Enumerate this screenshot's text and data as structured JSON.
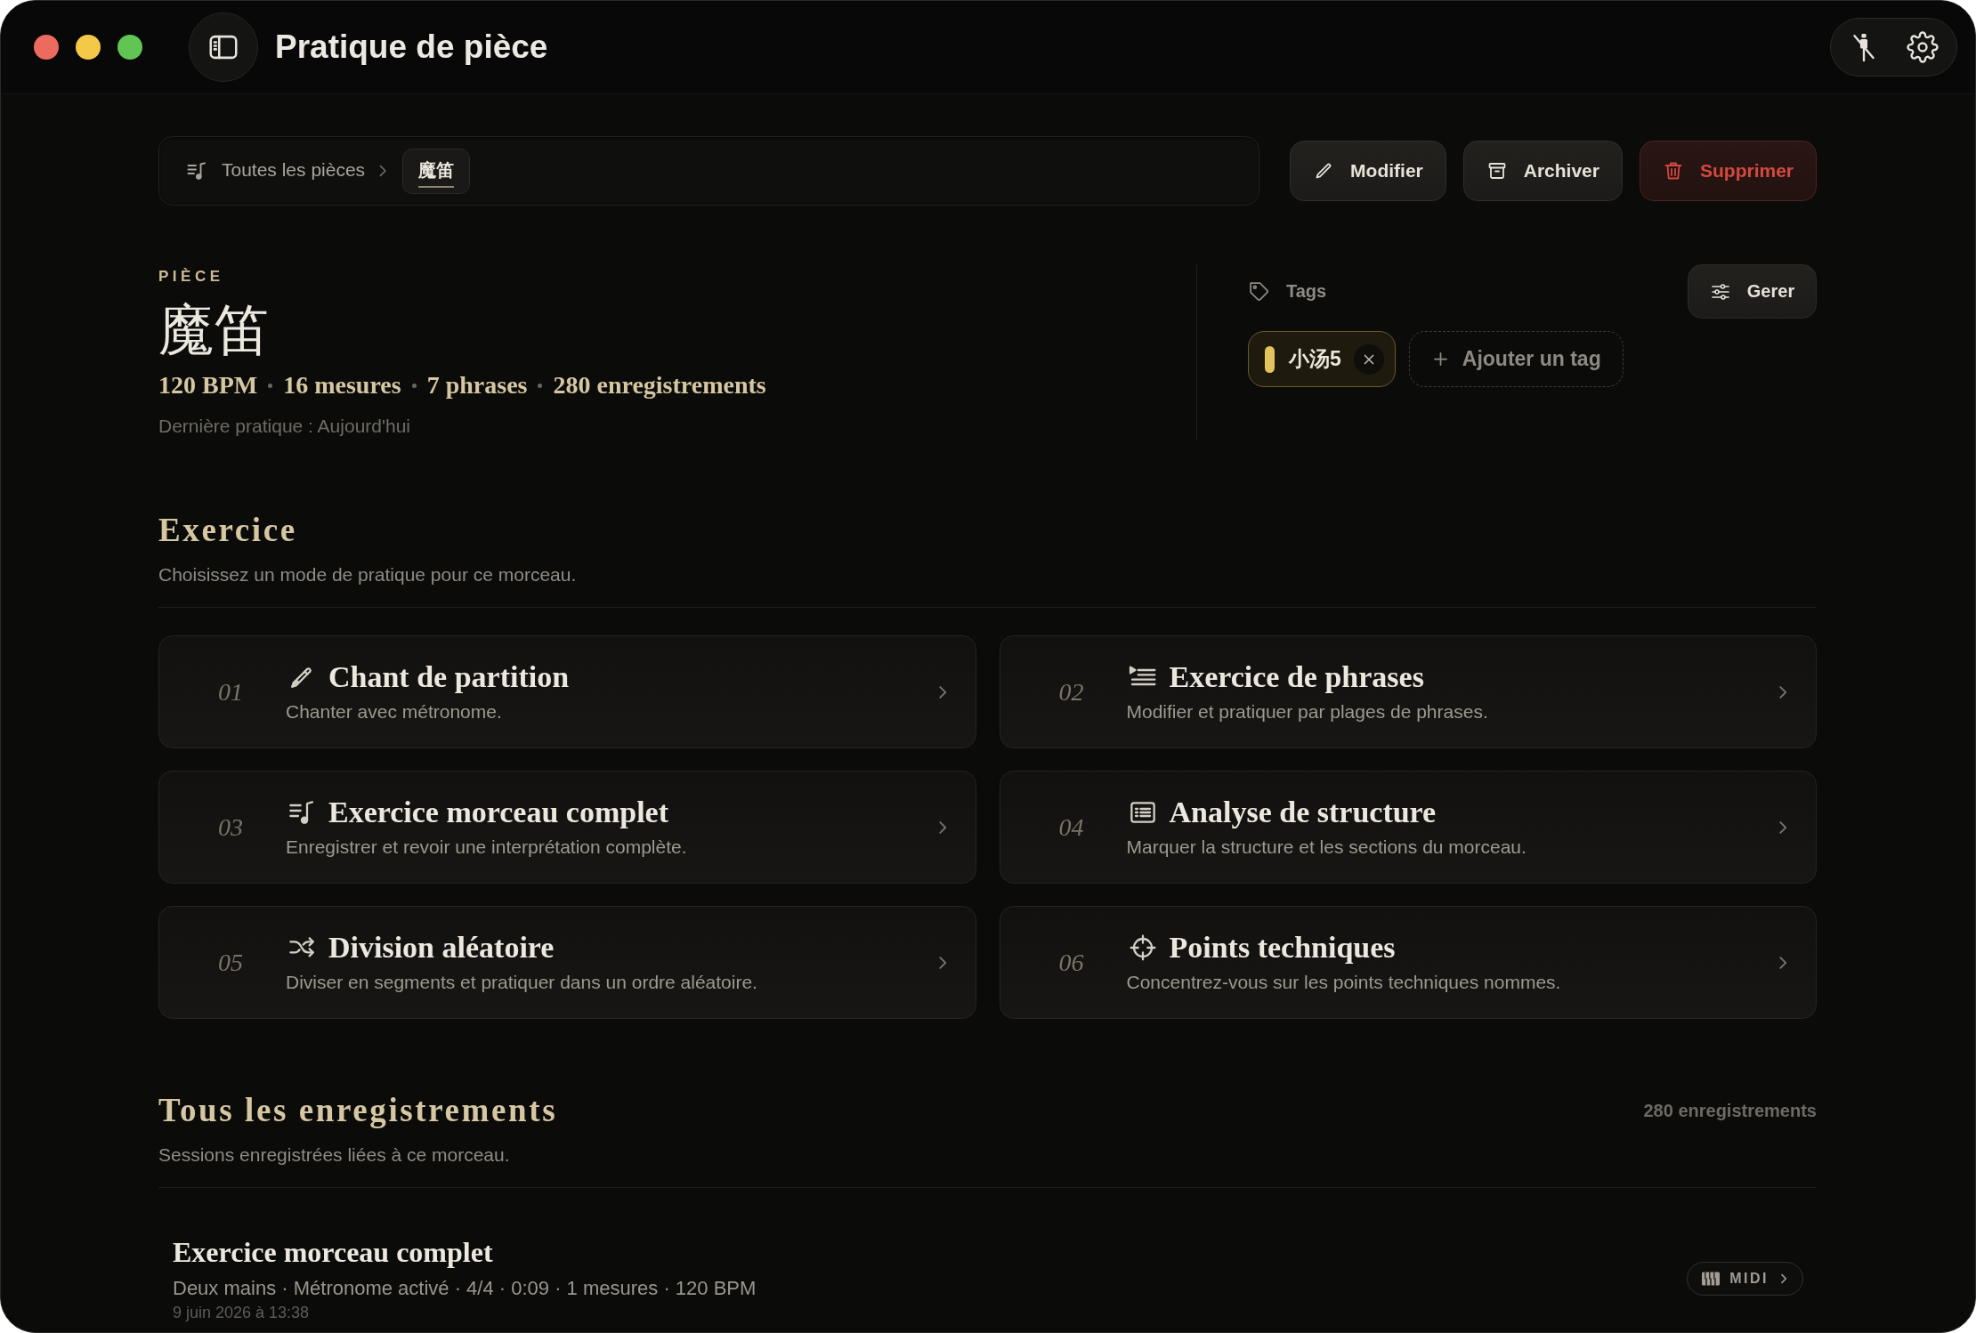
{
  "window": {
    "title": "Pratique de pièce"
  },
  "breadcrumb": [
    {
      "label": "Toutes les pièces",
      "selected": false
    },
    {
      "label": "魔笛",
      "selected": true
    }
  ],
  "actions": [
    {
      "kind": "edit",
      "label": "Modifier"
    },
    {
      "kind": "archive",
      "label": "Archiver"
    },
    {
      "kind": "delete",
      "label": "Supprimer"
    }
  ],
  "piece": {
    "eyebrow": "PIÈCE",
    "title": "魔笛",
    "stats": [
      "120 BPM",
      "16 mesures",
      "7 phrases",
      "280 enregistrements"
    ],
    "last_practice": "Dernière pratique : Aujourd'hui"
  },
  "tags": {
    "label": "Tags",
    "manage_button": "Gerer",
    "items": [
      {
        "label": "小汤5",
        "color": "#e2c35c"
      }
    ],
    "add_button": "Ajouter un tag"
  },
  "exercise": {
    "heading": "Exercice",
    "subtitle": "Choisissez un mode de pratique pour ce morceau.",
    "modes": [
      {
        "number": "01",
        "kind": "sing",
        "title": "Chant de partition",
        "description": "Chanter avec métronome."
      },
      {
        "number": "02",
        "kind": "phrases",
        "title": "Exercice de phrases",
        "description": "Modifier et pratiquer par plages de phrases."
      },
      {
        "number": "03",
        "kind": "full",
        "title": "Exercice morceau complet",
        "description": "Enregistrer et revoir une interprétation complète."
      },
      {
        "number": "04",
        "kind": "structure",
        "title": "Analyse de structure",
        "description": "Marquer la structure et les sections du morceau."
      },
      {
        "number": "05",
        "kind": "random",
        "title": "Division aléatoire",
        "description": "Diviser en segments et pratiquer dans un ordre aléatoire."
      },
      {
        "number": "06",
        "kind": "technique",
        "title": "Points techniques",
        "description": "Concentrez-vous sur les points techniques nommes."
      }
    ]
  },
  "recordings": {
    "heading": "Tous les enregistrements",
    "count": "280 enregistrements",
    "subtitle": "Sessions enregistrées liées à ce morceau.",
    "items": [
      {
        "title": "Exercice morceau complet",
        "meta": "Deux mains · Métronome activé · 4/4 · 0:09 · 1 mesures · 120 BPM",
        "date": "9 juin 2026 à 13:38",
        "badge": "MIDI"
      }
    ]
  }
}
